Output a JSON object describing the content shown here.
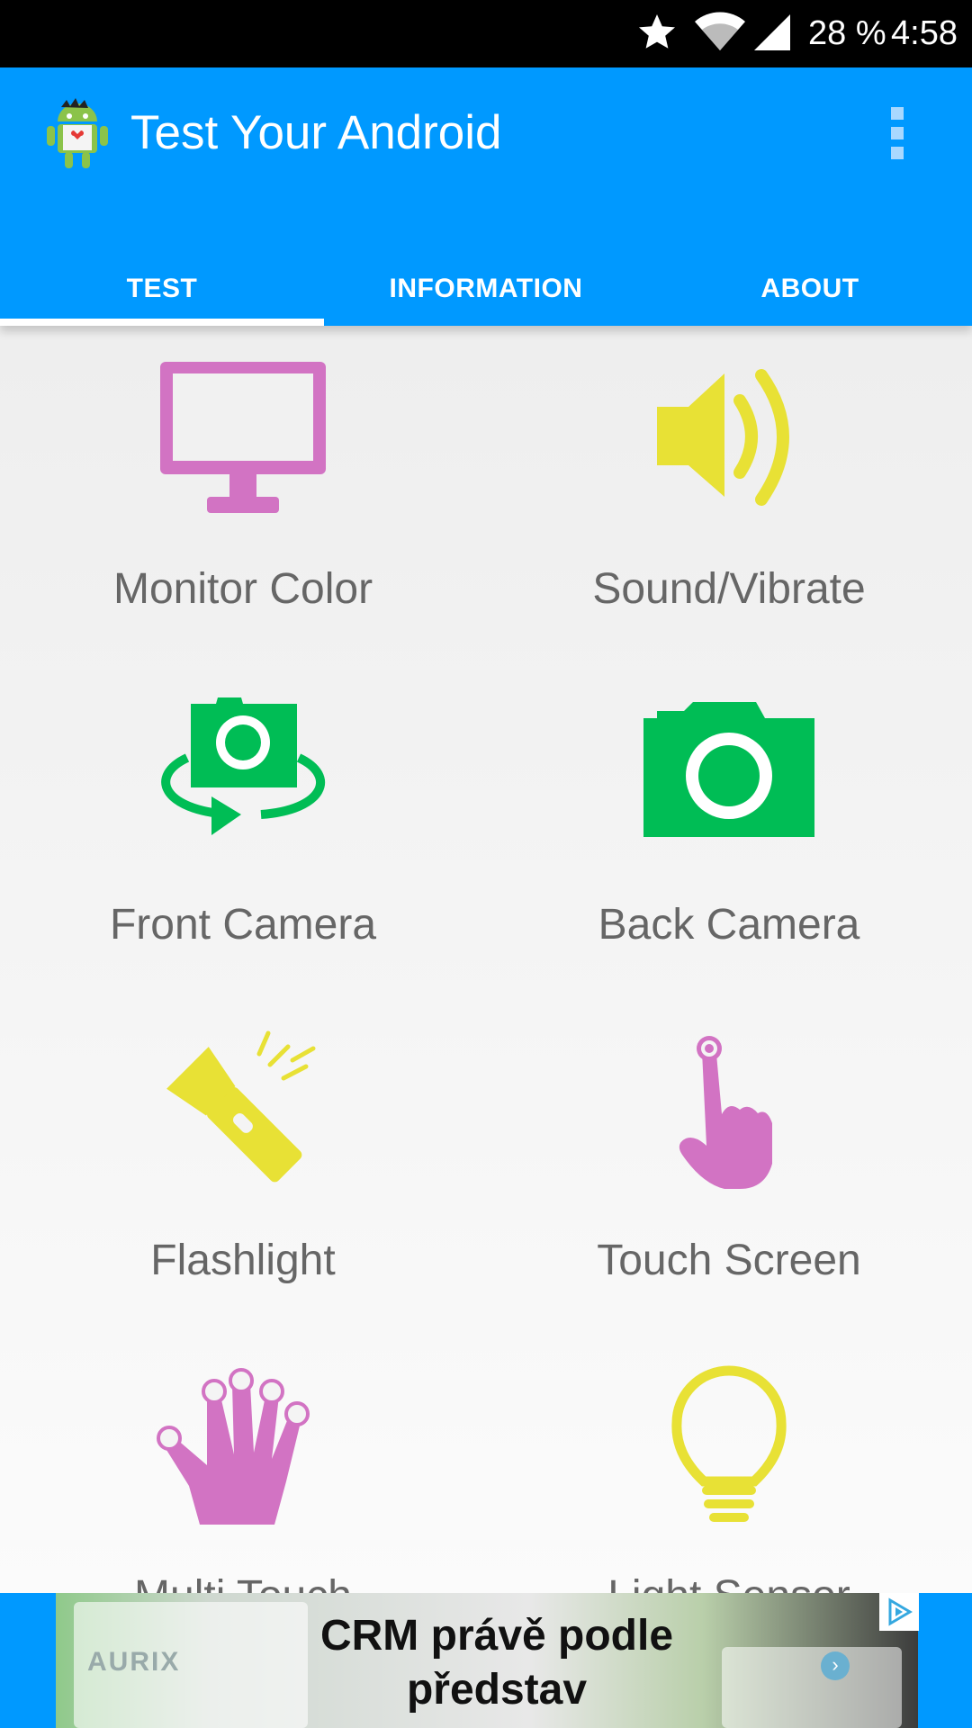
{
  "status_bar": {
    "battery": "28 %",
    "time": "4:58"
  },
  "app_bar": {
    "title": "Test Your Android"
  },
  "tabs": [
    {
      "label": "TEST",
      "selected": true
    },
    {
      "label": "INFORMATION",
      "selected": false
    },
    {
      "label": "ABOUT",
      "selected": false
    }
  ],
  "tests": [
    {
      "label": "Monitor Color",
      "icon": "monitor-icon",
      "color": "#d273c3"
    },
    {
      "label": "Sound/Vibrate",
      "icon": "speaker-icon",
      "color": "#e8e135"
    },
    {
      "label": "Front Camera",
      "icon": "front-camera-icon",
      "color": "#00bd55"
    },
    {
      "label": "Back Camera",
      "icon": "back-camera-icon",
      "color": "#00bd55"
    },
    {
      "label": "Flashlight",
      "icon": "flashlight-icon",
      "color": "#e8e135"
    },
    {
      "label": "Touch Screen",
      "icon": "finger-touch-icon",
      "color": "#d273c3"
    },
    {
      "label": "Multi Touch",
      "icon": "hand-multitouch-icon",
      "color": "#d273c3"
    },
    {
      "label": "Light Sensor",
      "icon": "light-bulb-icon",
      "color": "#e8e135"
    }
  ],
  "ad": {
    "headline_line1": "CRM právě podle",
    "headline_line2": "představ",
    "brand": "AURIX"
  },
  "colors": {
    "primary": "#0099ff",
    "pink": "#d273c3",
    "yellow": "#e8e135",
    "green": "#00bd55"
  }
}
